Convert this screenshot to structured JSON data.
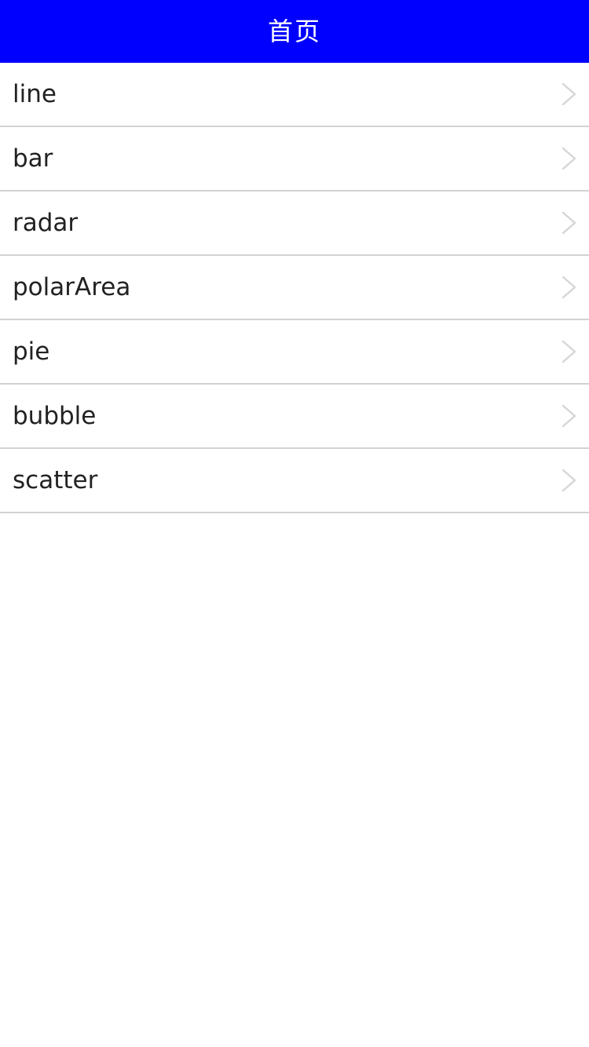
{
  "colors": {
    "nav_background": "#0000ff",
    "nav_text": "#ffffff",
    "item_text": "#222222",
    "divider": "#d2d2d2",
    "chevron": "#d6d6d6"
  },
  "header": {
    "title": "首页"
  },
  "list": {
    "items": [
      {
        "label": "line",
        "icon": "chevron-right-icon"
      },
      {
        "label": "bar",
        "icon": "chevron-right-icon"
      },
      {
        "label": "radar",
        "icon": "chevron-right-icon"
      },
      {
        "label": "polarArea",
        "icon": "chevron-right-icon"
      },
      {
        "label": "pie",
        "icon": "chevron-right-icon"
      },
      {
        "label": "bubble",
        "icon": "chevron-right-icon"
      },
      {
        "label": "scatter",
        "icon": "chevron-right-icon"
      }
    ]
  }
}
